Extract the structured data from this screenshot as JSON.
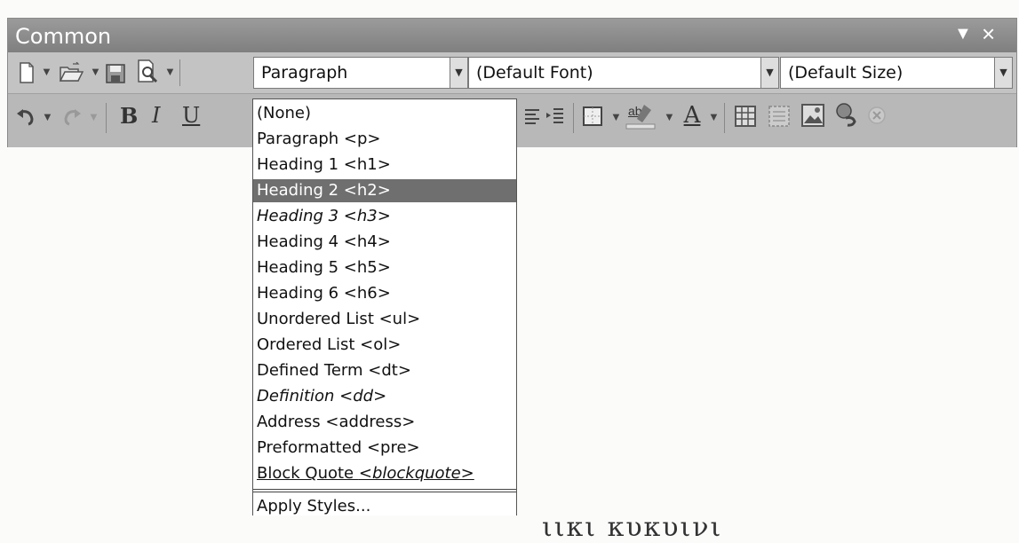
{
  "panel": {
    "title": "Common",
    "close_glyph": "×",
    "menu_glyph": "▼"
  },
  "toolbar": {
    "format_combo": "Paragraph",
    "font_combo": "(Default Font)",
    "size_combo": "(Default Size)",
    "bold": "B",
    "italic": "I",
    "underline": "U",
    "highlight_label": "ab",
    "font_color_label": "A"
  },
  "format_menu": {
    "items": [
      "(None)",
      "Paragraph <p>",
      "Heading 1 <h1>",
      "Heading 2 <h2>",
      "Heading 3 <h3>",
      "Heading 4 <h4>",
      "Heading 5 <h5>",
      "Heading 6 <h6>",
      "Unordered List <ul>",
      "Ordered List <ol>",
      "Defined Term <dt>",
      "Definition <dd>",
      "Address <address>",
      "Preformatted <pre>",
      "Block Quote <blockquote>",
      "Apply Styles..."
    ],
    "block_quote_label": "Block Quote ",
    "block_quote_tag": "<blockquote>",
    "selected": "Heading 2 <h2>"
  },
  "document": {
    "partial_text": "ιικι κυκυινι"
  },
  "icons": [
    "new-document-icon",
    "open-folder-icon",
    "save-icon",
    "preview-icon",
    "undo-icon",
    "redo-icon",
    "align-icon",
    "indent-icon",
    "border-icon",
    "highlight-icon",
    "font-color-icon",
    "table-icon",
    "layer-icon",
    "image-icon",
    "link-icon",
    "unlink-icon",
    "menu-triangle-icon",
    "close-icon"
  ]
}
